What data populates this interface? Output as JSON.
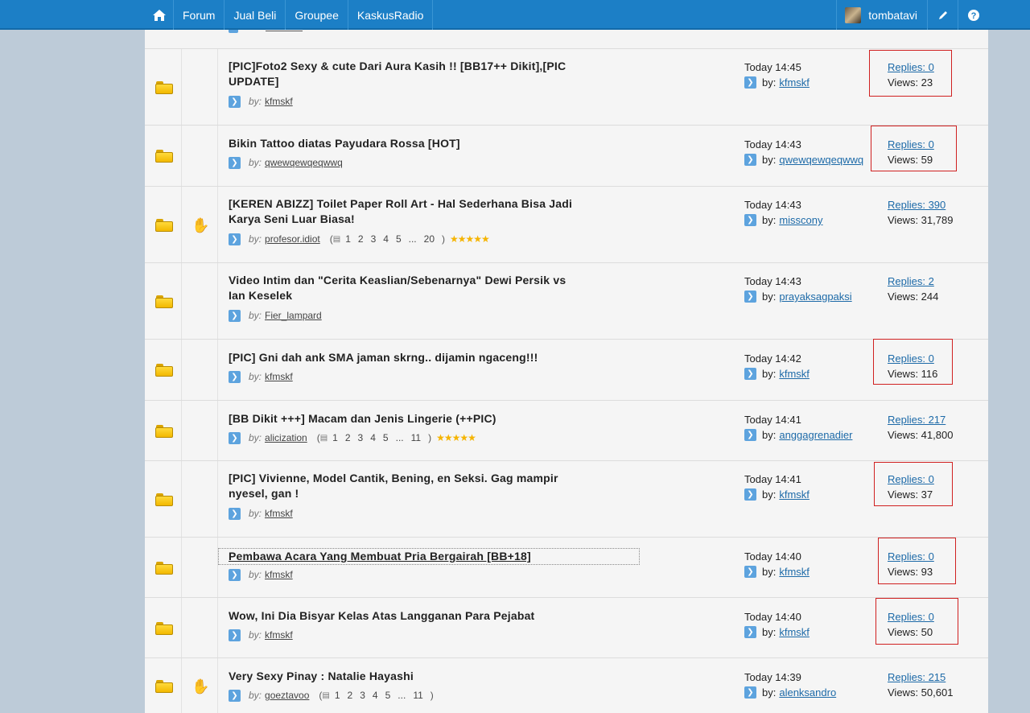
{
  "nav": {
    "items": [
      "Forum",
      "Jual Beli",
      "Groupee",
      "KaskusRadio"
    ],
    "username": "tombatavi"
  },
  "threads": [
    {
      "title_line1": "[PIC]Foto2 Sexy & cute Dari Aura Kasih !! [BB17++ Dikit],[PIC",
      "title_line2": "UPDATE]",
      "author": "kfmskf",
      "time": "Today 14:45",
      "last_poster": "kfmskf",
      "replies": "Replies: 0",
      "views": "Views: 23",
      "hot": false,
      "pages": null,
      "stars": null
    },
    {
      "title_line1": "Bikin Tattoo diatas Payudara Rossa [HOT]",
      "title_line2": "",
      "author": "qwewqewqeqwwq",
      "time": "Today 14:43",
      "last_poster": "qwewqewqeqwwq",
      "replies": "Replies: 0",
      "views": "Views: 59",
      "hot": false,
      "pages": null,
      "stars": null
    },
    {
      "title_line1": "[KEREN ABIZZ] Toilet Paper Roll Art - Hal Sederhana Bisa Jadi",
      "title_line2": "Karya Seni Luar Biasa!",
      "author": "profesor.idiot",
      "time": "Today 14:43",
      "last_poster": "misscony",
      "replies": "Replies: 390",
      "views": "Views: 31,789",
      "hot": true,
      "pages": [
        "1",
        "2",
        "3",
        "4",
        "5",
        "...",
        "20"
      ],
      "stars": "★★★★★"
    },
    {
      "title_line1": "Video Intim dan \"Cerita Keaslian/Sebenarnya\" Dewi Persik vs",
      "title_line2": "Ian Keselek",
      "author": "Fier_lampard",
      "time": "Today 14:43",
      "last_poster": "prayaksagpaksi",
      "replies": "Replies: 2",
      "views": "Views: 244",
      "hot": false,
      "pages": null,
      "stars": null
    },
    {
      "title_line1": "[PIC] Gni dah ank SMA jaman skrng.. dijamin ngaceng!!!",
      "title_line2": "",
      "author": "kfmskf",
      "time": "Today 14:42",
      "last_poster": "kfmskf",
      "replies": "Replies: 0",
      "views": "Views: 116",
      "hot": false,
      "pages": null,
      "stars": null
    },
    {
      "title_line1": "[BB Dikit +++] Macam dan Jenis Lingerie (++PIC)",
      "title_line2": "",
      "author": "alicization",
      "time": "Today 14:41",
      "last_poster": "anggagrenadier",
      "replies": "Replies: 217",
      "views": "Views: 41,800",
      "hot": false,
      "pages": [
        "1",
        "2",
        "3",
        "4",
        "5",
        "...",
        "11"
      ],
      "stars": "★★★★★"
    },
    {
      "title_line1": "[PIC] Vivienne, Model Cantik, Bening, en Seksi. Gag mampir",
      "title_line2": "nyesel, gan !",
      "author": "kfmskf",
      "time": "Today 14:41",
      "last_poster": "kfmskf",
      "replies": "Replies: 0",
      "views": "Views: 37",
      "hot": false,
      "pages": null,
      "stars": null
    },
    {
      "title_line1": "Pembawa Acara Yang Membuat Pria Bergairah [BB+18]",
      "title_line2": "",
      "author": "kfmskf",
      "time": "Today 14:40",
      "last_poster": "kfmskf",
      "replies": "Replies: 0",
      "views": "Views: 93",
      "hot": false,
      "pages": null,
      "stars": null
    },
    {
      "title_line1": "Wow, Ini Dia Bisyar Kelas Atas Langganan Para Pejabat",
      "title_line2": "",
      "author": "kfmskf",
      "time": "Today 14:40",
      "last_poster": "kfmskf",
      "replies": "Replies: 0",
      "views": "Views: 50",
      "hot": false,
      "pages": null,
      "stars": null
    },
    {
      "title_line1": "Very Sexy Pinay : Natalie Hayashi",
      "title_line2": "",
      "author": "goeztavoo",
      "time": "Today 14:39",
      "last_poster": "alenksandro",
      "replies": "Replies: 215",
      "views": "Views: 50,601",
      "hot": true,
      "pages": [
        "1",
        "2",
        "3",
        "4",
        "5",
        "...",
        "11"
      ],
      "stars": null
    }
  ],
  "labels": {
    "by": "by:",
    "lastpost_by": "by:"
  },
  "colors": {
    "nav_bg": "#1c7fc6",
    "link": "#1d6aa8",
    "highlight_box": "#d02020"
  }
}
